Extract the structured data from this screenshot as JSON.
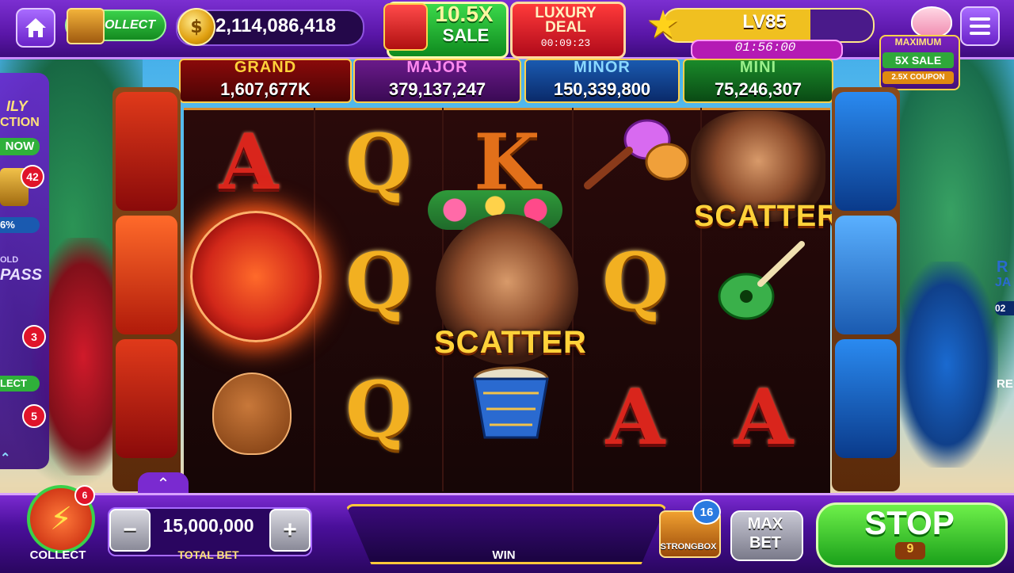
{
  "topbar": {
    "collect_label": "COLLECT",
    "coin_symbol": "$",
    "coins": "2,114,086,418",
    "sale": {
      "percent": "10.5X",
      "word": "SALE"
    },
    "deal": {
      "line1": "LUXURY",
      "line2": "DEAL",
      "timer": "00:09:23"
    },
    "level": {
      "label": "LV85",
      "timer": "01:56:00"
    },
    "promo": {
      "line1": "MAXIMUM",
      "line2": "5X SALE",
      "line3": "2.5X COUPON"
    }
  },
  "jackpots": [
    {
      "label": "GRAND",
      "value": "1,607,677K",
      "color": "#ffd23a"
    },
    {
      "label": "MAJOR",
      "value": "379,137,247",
      "color": "#ff8af0"
    },
    {
      "label": "MINOR",
      "value": "150,339,800",
      "color": "#8ad8ff"
    },
    {
      "label": "MINI",
      "value": "75,246,307",
      "color": "#9af08a"
    }
  ],
  "reels": {
    "r1": {
      "s1": "A",
      "s2": "sun",
      "s3": "coconut-drink"
    },
    "r2": {
      "s1": "Q",
      "s2": "Q",
      "s3": "Q"
    },
    "r3": {
      "s1": "K",
      "s2": "SCATTER",
      "s3": "drum"
    },
    "r4": {
      "s1": "maracas",
      "s2": "Q",
      "s3": "A"
    },
    "r5": {
      "s1": "SCATTER",
      "s2": "guitar",
      "s3": "A"
    }
  },
  "side_panel": {
    "line1": "ILY",
    "line2": "CTION",
    "now_label": "NOW",
    "badge_top": "42",
    "progress": "6%",
    "pass_line1": "OLD",
    "pass_line2": "PASS",
    "badge_mid": "3",
    "collect_label": "LECT",
    "badge_bottom": "5"
  },
  "right_panel": {
    "line1": "R",
    "line2": "JA",
    "badge": "02",
    "label": "RE"
  },
  "bottombar": {
    "collect_label": "COLLECT",
    "collect_badge": "6",
    "minus_label": "−",
    "plus_label": "+",
    "total_bet": "15,000,000",
    "total_bet_label": "TOTAL BET",
    "win_label": "WIN",
    "strongbox_badge": "16",
    "strongbox_label": "STRONGBOX",
    "maxbet_l1": "MAX",
    "maxbet_l2": "BET",
    "stop_label": "STOP",
    "stop_count": "9"
  },
  "colors": {
    "accent_purple": "#6a22c9",
    "gold": "#f2b021",
    "green": "#1aa01a"
  },
  "icons": [
    "home-icon",
    "chest-icon",
    "coin-icon",
    "gift-icon",
    "star-icon",
    "piggy-icon",
    "menu-icon",
    "bolt-icon",
    "strongbox-icon",
    "arrow-up-icon"
  ]
}
